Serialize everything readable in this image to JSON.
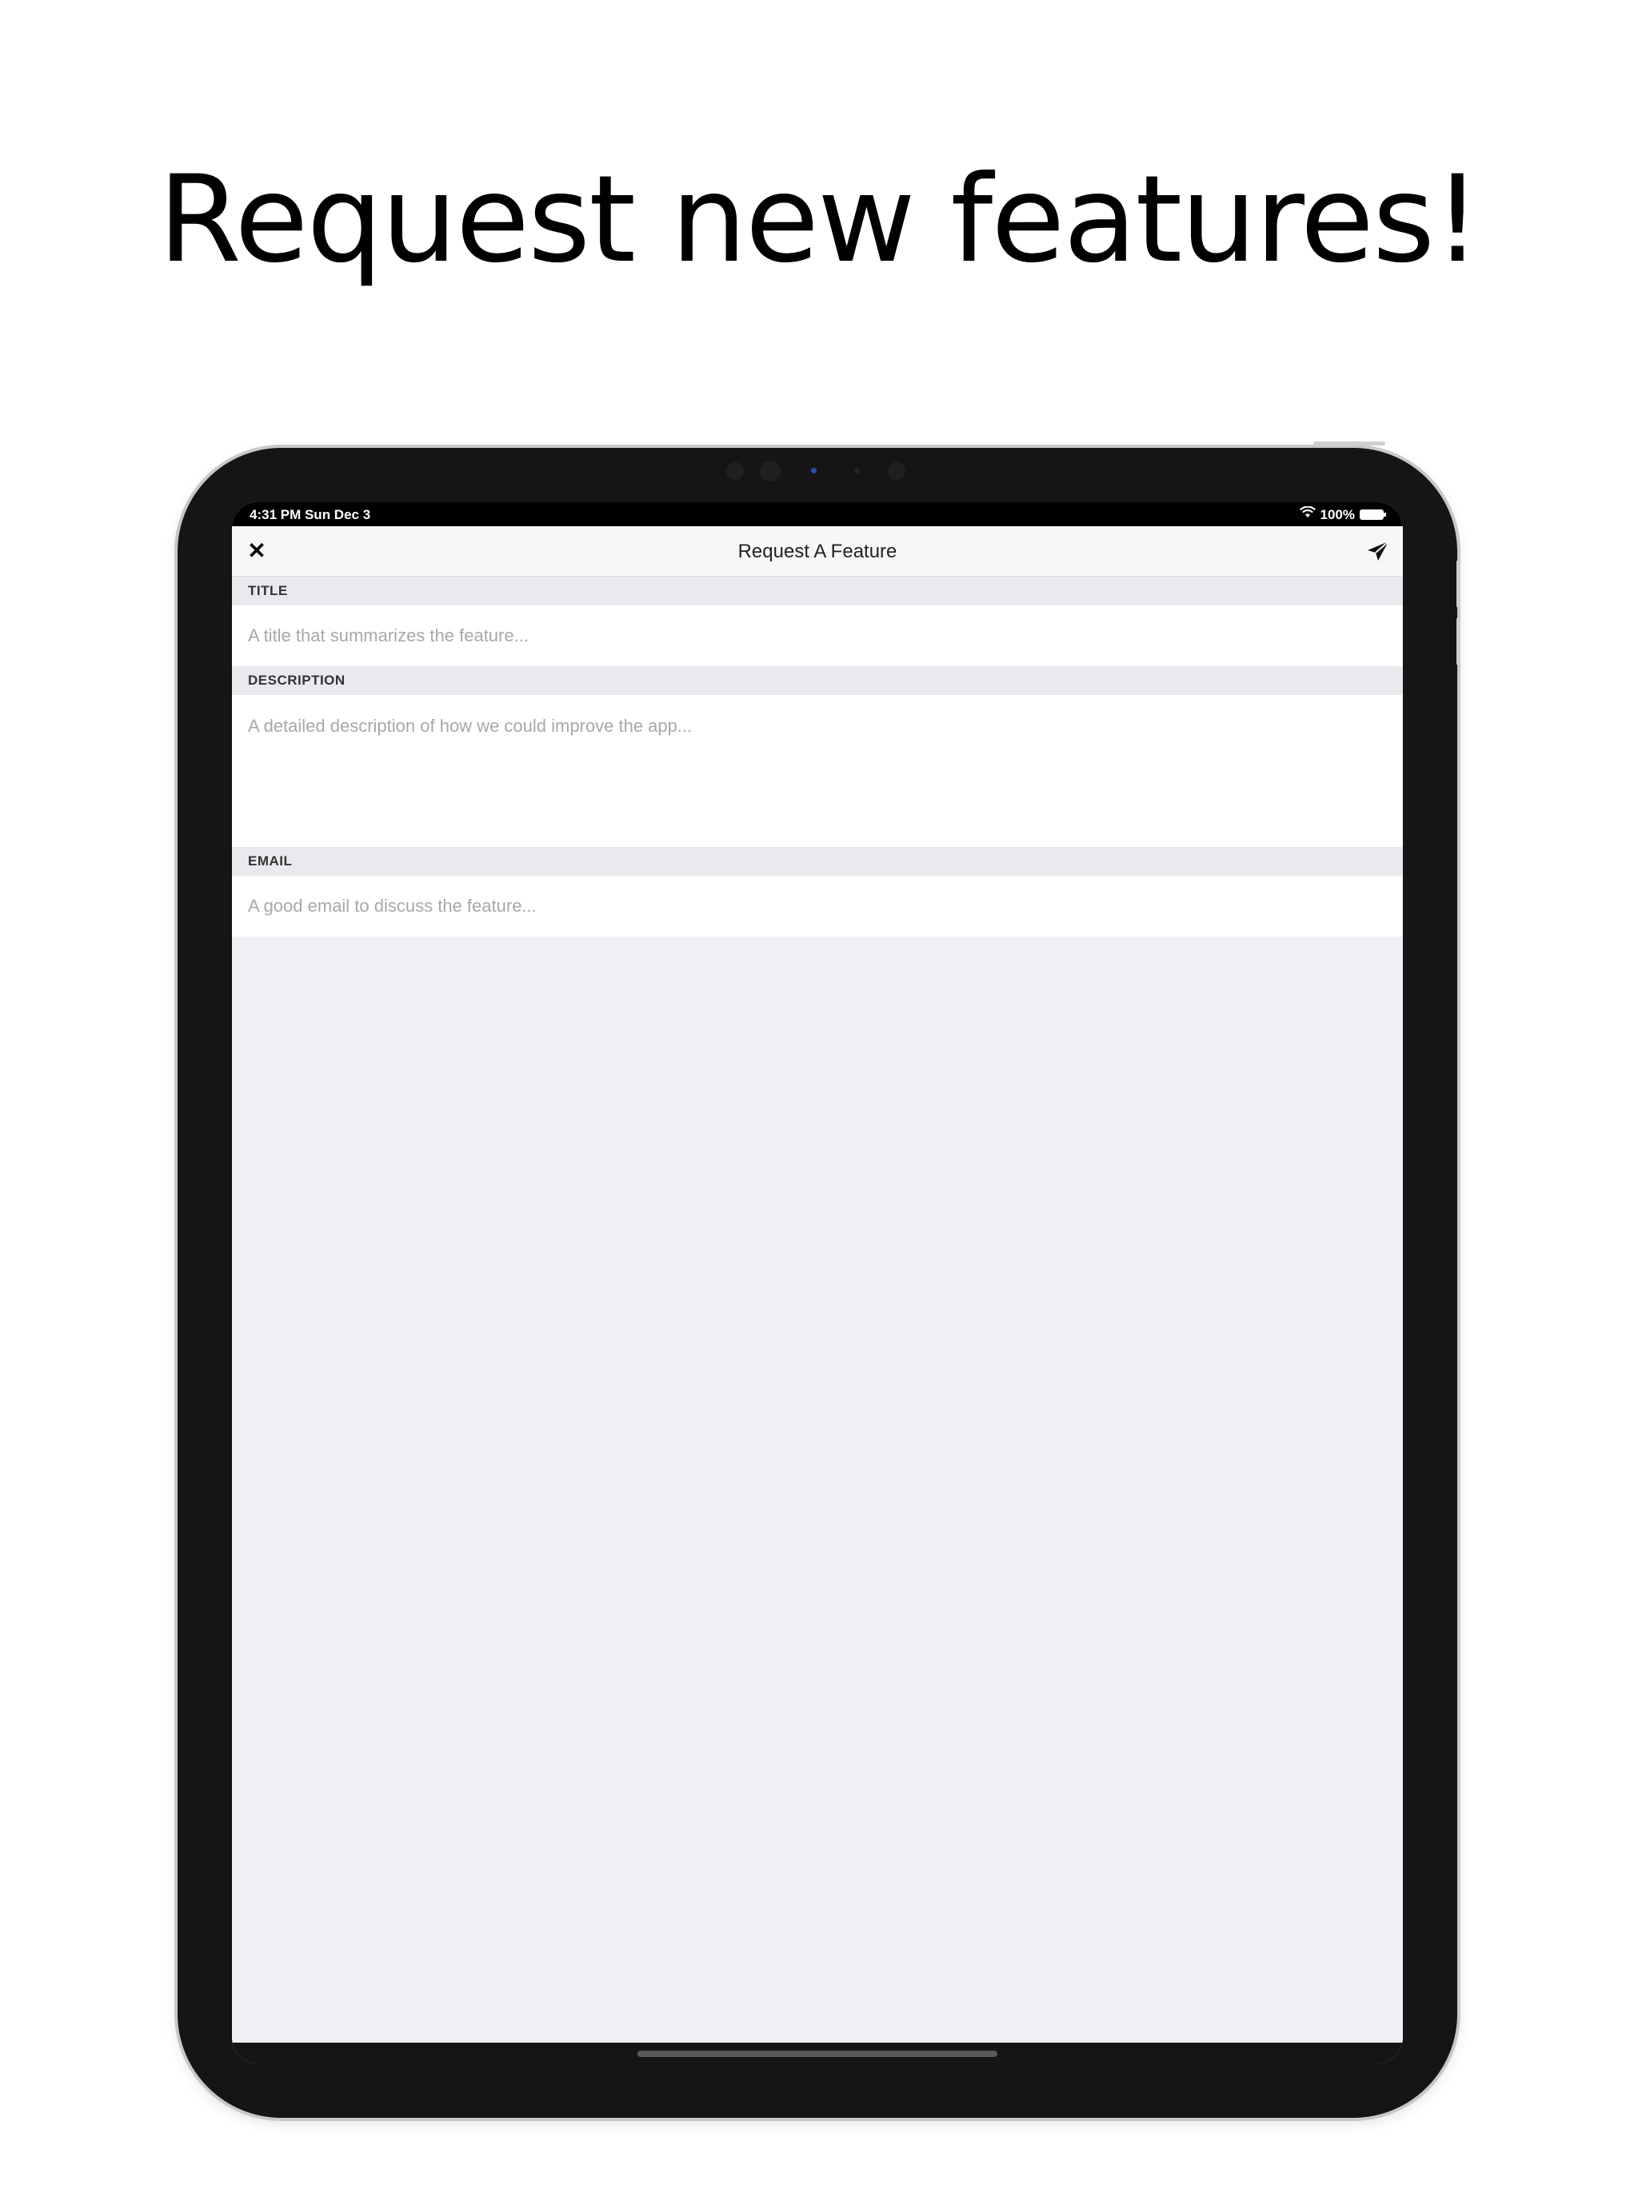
{
  "headline": "Request new features!",
  "status_bar": {
    "time_date": "4:31 PM   Sun Dec 3",
    "battery_text": "100%"
  },
  "nav": {
    "title": "Request A Feature"
  },
  "form": {
    "title": {
      "label": "TITLE",
      "placeholder": "A title that summarizes the feature..."
    },
    "description": {
      "label": "DESCRIPTION",
      "placeholder": "A detailed description of how we could improve the app..."
    },
    "email": {
      "label": "EMAIL",
      "placeholder": "A good email to discuss the feature..."
    }
  },
  "icons": {
    "close": "close-icon",
    "send": "paper-plane-icon",
    "wifi": "wifi-icon",
    "battery": "battery-icon"
  },
  "colors": {
    "background": "#efeff4",
    "section_header": "#e9e9ee",
    "bezel": "#151515",
    "placeholder": "#a8a8a8"
  }
}
